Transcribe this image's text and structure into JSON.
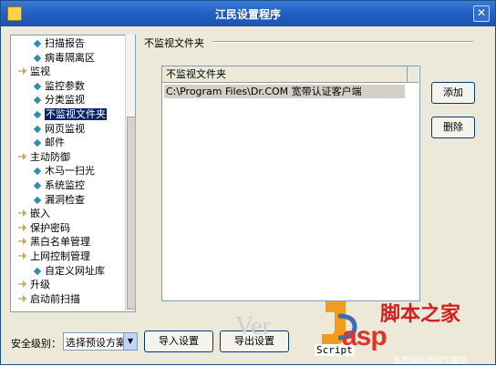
{
  "window": {
    "title": "江民设置程序",
    "close": "✕"
  },
  "tree": [
    {
      "label": "扫描报告",
      "level": 2,
      "leaf": true
    },
    {
      "label": "病毒隔离区",
      "level": 2,
      "leaf": true
    },
    {
      "label": "监视",
      "level": 1,
      "expanded": true
    },
    {
      "label": "监控参数",
      "level": 2,
      "leaf": true
    },
    {
      "label": "分类监视",
      "level": 2,
      "leaf": true
    },
    {
      "label": "不监视文件夹",
      "level": 2,
      "leaf": true,
      "selected": true
    },
    {
      "label": "网页监视",
      "level": 2,
      "leaf": true
    },
    {
      "label": "邮件",
      "level": 2,
      "leaf": true
    },
    {
      "label": "主动防御",
      "level": 1,
      "expanded": true
    },
    {
      "label": "木马一扫光",
      "level": 2,
      "leaf": true
    },
    {
      "label": "系统监控",
      "level": 2,
      "leaf": true
    },
    {
      "label": "漏洞检查",
      "level": 2,
      "leaf": true
    },
    {
      "label": "嵌入",
      "level": 1
    },
    {
      "label": "保护密码",
      "level": 1
    },
    {
      "label": "黑白名单管理",
      "level": 1
    },
    {
      "label": "上网控制管理",
      "level": 1,
      "expanded": true
    },
    {
      "label": "自定义网址库",
      "level": 2,
      "leaf": true
    },
    {
      "label": "升级",
      "level": 1
    },
    {
      "label": "启动前扫描",
      "level": 1
    }
  ],
  "panel": {
    "section_title": "不监视文件夹",
    "list_header": "不监视文件夹",
    "rows": [
      "C:\\Program Files\\Dr.COM 宽带认证客户端"
    ],
    "add_button": "添加",
    "delete_button": "删除"
  },
  "bottom": {
    "security_label": "安全级别：",
    "security_select": "选择预设方案",
    "import_button": "导入设置",
    "export_button": "导出设置"
  },
  "watermark": {
    "ver": "Ver",
    "script": "Script",
    "asp": "asp",
    "site": "脚本之家",
    "footer": "免费网站源码下载站"
  }
}
